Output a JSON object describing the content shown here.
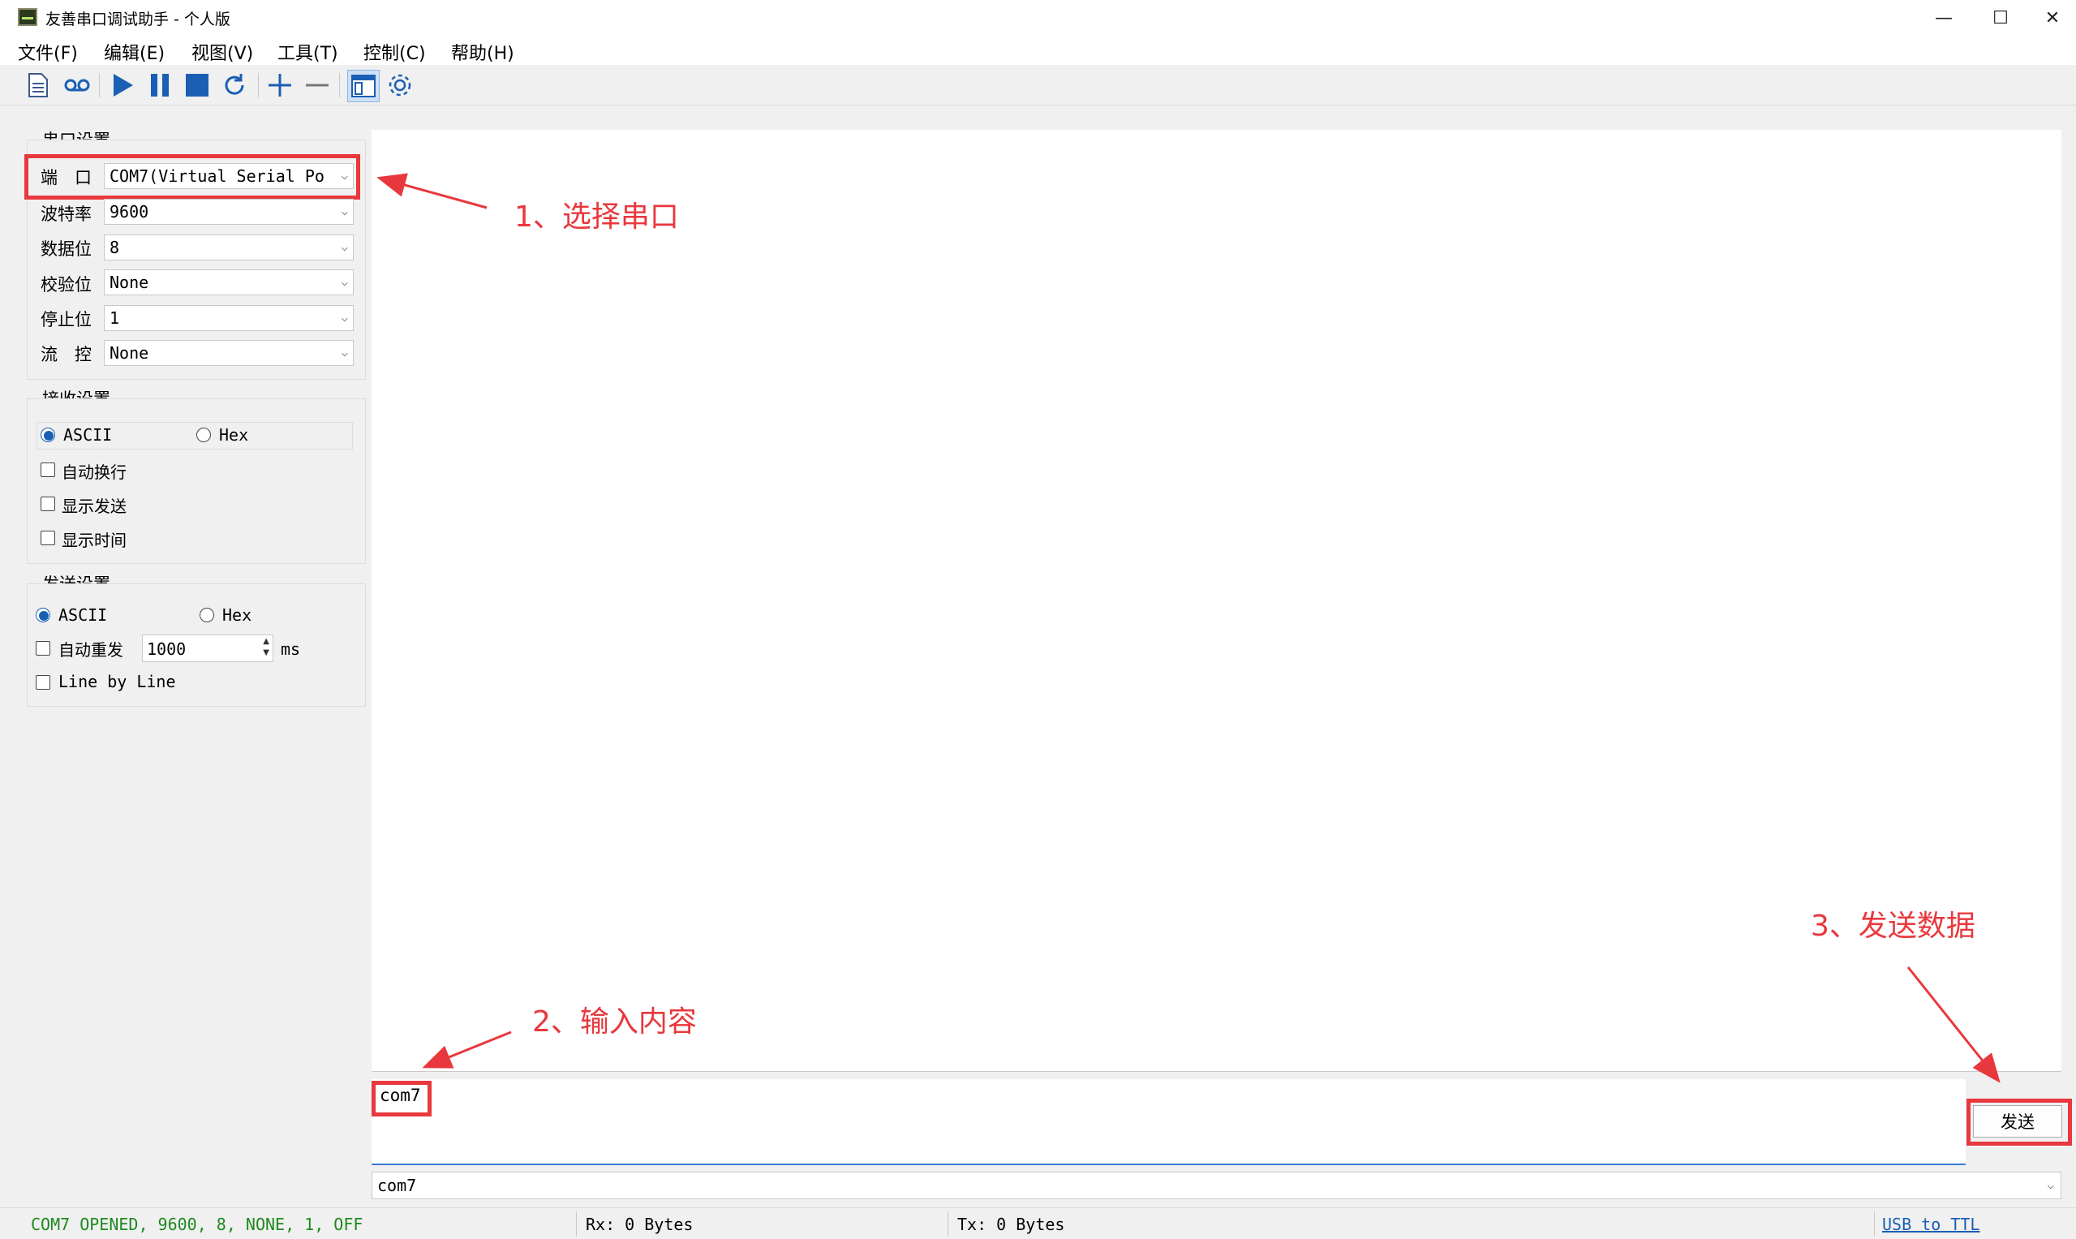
{
  "window": {
    "title": "友善串口调试助手 - 个人版",
    "minimize": "—",
    "maximize": "☐",
    "close": "✕"
  },
  "menu": [
    {
      "label": "文件(F)"
    },
    {
      "label": "编辑(E)"
    },
    {
      "label": "视图(V)"
    },
    {
      "label": "工具(T)"
    },
    {
      "label": "控制(C)"
    },
    {
      "label": "帮助(H)"
    }
  ],
  "serial_settings": {
    "title": "串口设置",
    "port": {
      "label": "端　口",
      "value": "COM7(Virtual Serial Po"
    },
    "baud": {
      "label": "波特率",
      "value": "9600"
    },
    "data_bits": {
      "label": "数据位",
      "value": "8"
    },
    "parity": {
      "label": "校验位",
      "value": "None"
    },
    "stop_bits": {
      "label": "停止位",
      "value": "1"
    },
    "flow_control": {
      "label": "流　控",
      "value": "None"
    }
  },
  "receive_settings": {
    "title": "接收设置",
    "ascii": "ASCII",
    "hex": "Hex",
    "auto_wrap": "自动换行",
    "show_send": "显示发送",
    "show_time": "显示时间"
  },
  "send_settings": {
    "title": "发送设置",
    "ascii": "ASCII",
    "hex": "Hex",
    "auto_resend": "自动重发",
    "interval": "1000",
    "unit": "ms",
    "line_by_line": "Line by Line"
  },
  "send": {
    "text": "com7",
    "button": "发送",
    "history": "com7"
  },
  "annotations": {
    "step1": "1、选择串口",
    "step2": "2、输入内容",
    "step3": "3、发送数据"
  },
  "status": {
    "port_state": "COM7 OPENED, 9600, 8, NONE, 1, OFF",
    "rx": "Rx: 0 Bytes",
    "tx": "Tx: 0 Bytes",
    "link": "USB to TTL"
  },
  "colors": {
    "annotation": "#e8383d",
    "status_ok": "#1e8a1e",
    "accent": "#1a5fb4"
  }
}
